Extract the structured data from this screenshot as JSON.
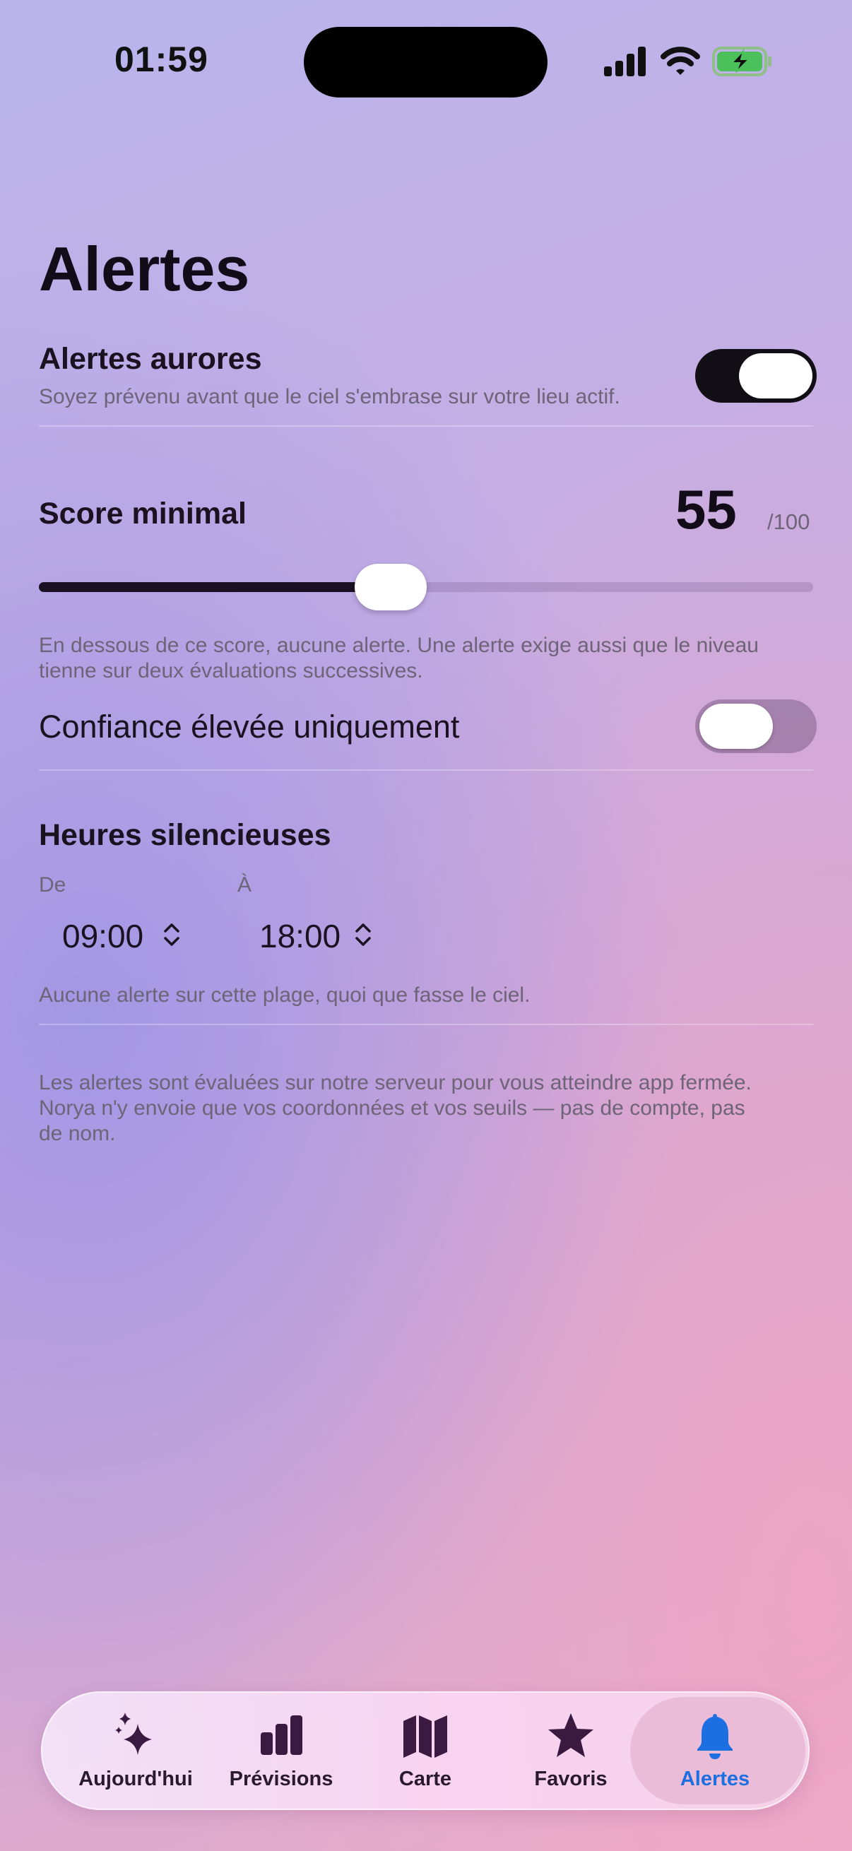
{
  "status_bar": {
    "time": "01:59"
  },
  "page": {
    "title": "Alertes"
  },
  "aurora_alerts": {
    "title": "Alertes aurores",
    "subtitle": "Soyez prévenu avant que le ciel s'embrase sur votre lieu actif.",
    "enabled": true
  },
  "min_score": {
    "title": "Score minimal",
    "value": "55",
    "max_label": "/100",
    "slider_fraction": 0.45,
    "help": "En dessous de ce score, aucune alerte. Une alerte exige aussi que le niveau tienne sur deux évaluations successives."
  },
  "high_confidence": {
    "label": "Confiance élevée uniquement",
    "enabled": false
  },
  "quiet_hours": {
    "title": "Heures silencieuses",
    "from_label": "De",
    "from_value": "09:00",
    "to_label": "À",
    "to_value": "18:00",
    "help": "Aucune alerte sur cette plage, quoi que fasse le ciel."
  },
  "footer_note": "Les alertes sont évaluées sur notre serveur pour vous atteindre app fermée. Norya n'y envoie que vos coordonnées et vos seuils — pas de compte, pas de nom.",
  "tabbar": {
    "tabs": [
      {
        "label": "Aujourd'hui",
        "icon": "sparkles-icon"
      },
      {
        "label": "Prévisions",
        "icon": "bar-chart-icon"
      },
      {
        "label": "Carte",
        "icon": "map-icon"
      },
      {
        "label": "Favoris",
        "icon": "star-icon"
      },
      {
        "label": "Alertes",
        "icon": "bell-icon"
      }
    ],
    "active_index": 4,
    "active_color": "#1c6fe0"
  }
}
